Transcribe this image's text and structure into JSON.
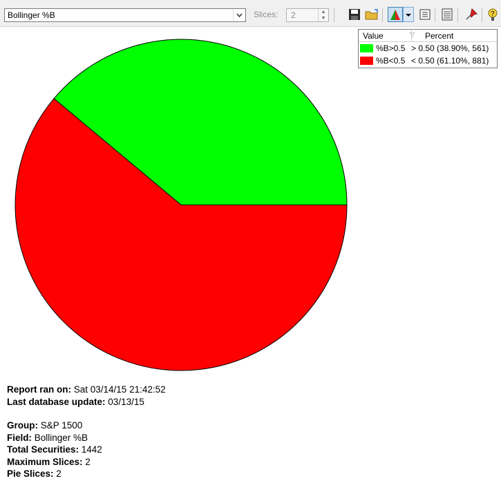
{
  "toolbar": {
    "field_value": "Bollinger %B",
    "slices_label": "Slices:",
    "slices_value": "2"
  },
  "legend": {
    "col_value": "Value",
    "col_percent": "Percent",
    "rows": [
      {
        "label": "%B>0.5",
        "percent": "> 0.50 (38.90%, 561)",
        "color": "#00ff00"
      },
      {
        "label": "%B<0.5",
        "percent": "< 0.50 (61.10%, 881)",
        "color": "#ff0000"
      }
    ]
  },
  "chart_data": {
    "type": "pie",
    "slices": [
      {
        "label": "%B>0.5",
        "percent": 38.9,
        "count": 561,
        "color": "#00ff00"
      },
      {
        "label": "%B<0.5",
        "percent": 61.1,
        "count": 881,
        "color": "#ff0000"
      }
    ]
  },
  "report": {
    "ran_label": "Report ran on:",
    "ran_value": " Sat 03/14/15 21:42:52",
    "db_label": "Last database update:",
    "db_value": " 03/13/15",
    "group_label": "Group:",
    "group_value": " S&P 1500",
    "field_label": "Field:",
    "field_value": " Bollinger %B",
    "total_label": "Total Securities:",
    "total_value": " 1442",
    "max_label": "Maximum Slices:",
    "max_value": " 2",
    "pie_label": "Pie Slices:",
    "pie_value": " 2"
  }
}
